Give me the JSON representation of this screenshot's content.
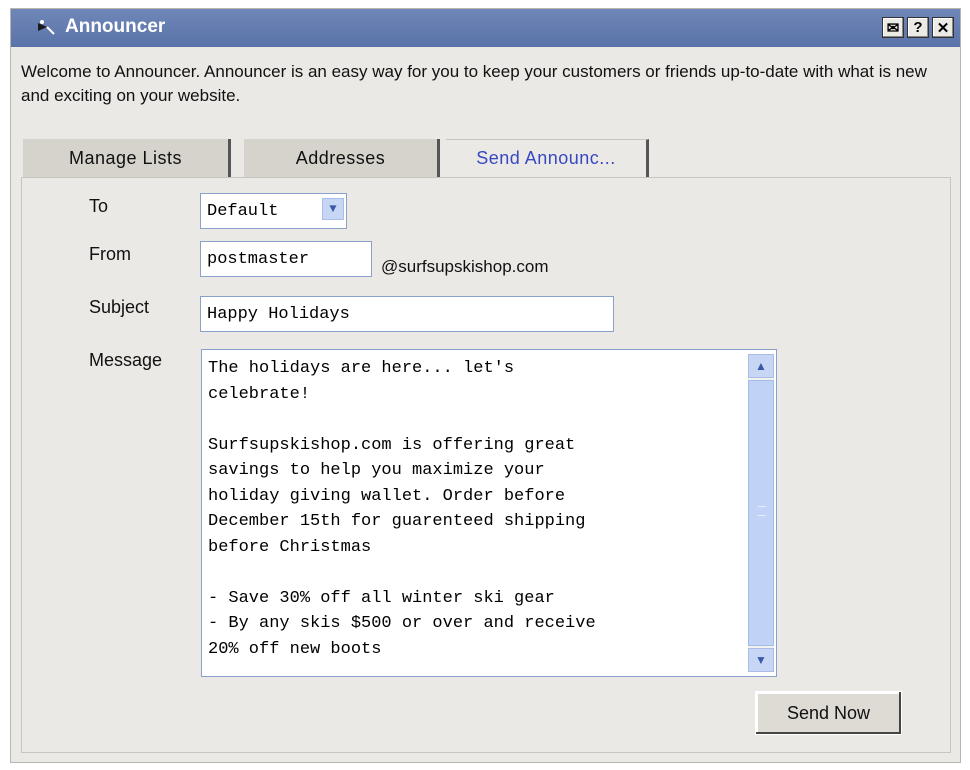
{
  "window": {
    "title": "Announcer",
    "buttons": [
      {
        "name": "envelope-icon",
        "glyph": "✉"
      },
      {
        "name": "help-icon",
        "glyph": "?"
      },
      {
        "name": "close-icon",
        "glyph": "✕"
      }
    ]
  },
  "intro": {
    "text": "Welcome to Announcer. Announcer is an easy way for you to keep your customers or friends up-to-date with what is new and exciting on your website."
  },
  "tabs": [
    {
      "label": "Manage Lists",
      "active": false
    },
    {
      "label": "Addresses",
      "active": false
    },
    {
      "label": "Send Announc...",
      "active": true
    }
  ],
  "form": {
    "to_label": "To",
    "to_value": "Default",
    "from_label": "From",
    "from_value": "postmaster",
    "from_domain": "@surfsupskishop.com",
    "subject_label": "Subject",
    "subject_value": "Happy Holidays",
    "message_label": "Message",
    "message_value": "The holidays are here... let's\ncelebrate!\n\nSurfsupskishop.com is offering great\nsavings to help you maximize your\nholiday giving wallet. Order before\nDecember 15th for guarenteed shipping\nbefore Christmas\n\n- Save 30% off all winter ski gear\n- By any skis $500 or over and receive\n20% off new boots"
  },
  "actions": {
    "send_label": "Send Now"
  },
  "colors": {
    "titlebar": "#5a73a8",
    "active_tab_text": "#3848c0",
    "scrollbar": "#c0d2f5"
  }
}
